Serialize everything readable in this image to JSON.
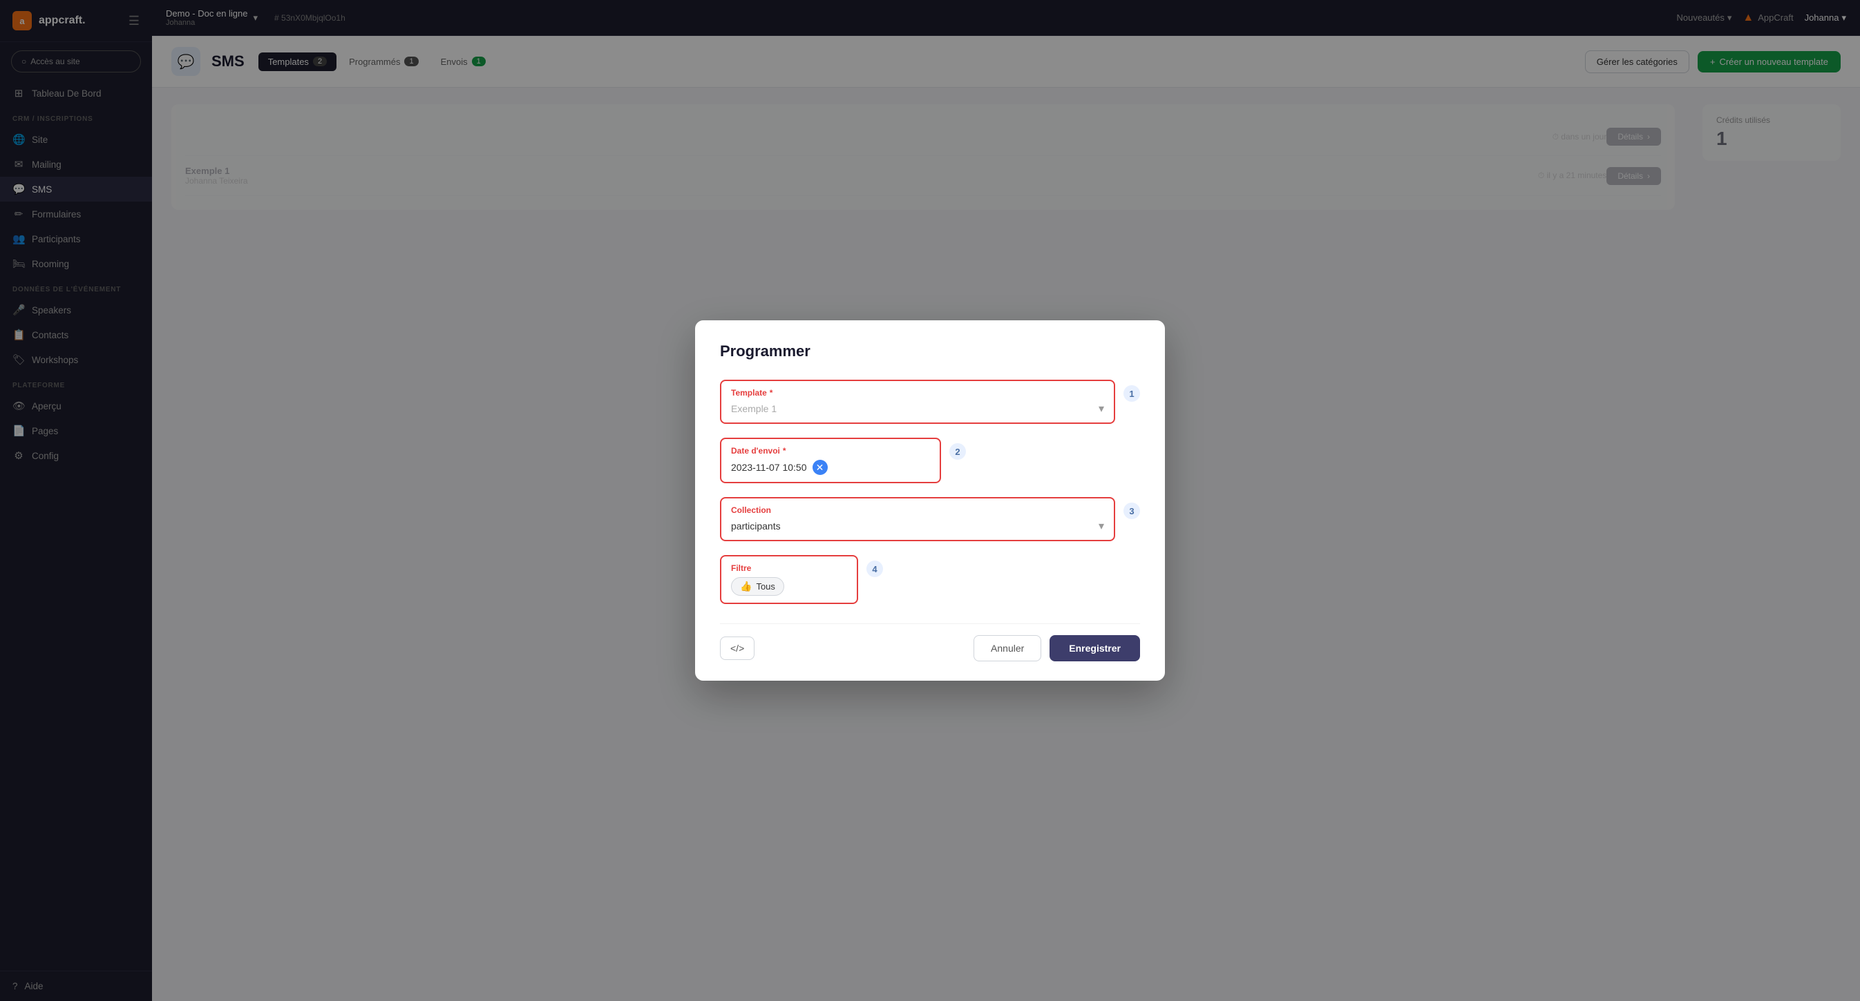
{
  "app": {
    "logo_text": "appcraft.",
    "logo_abbr": "a"
  },
  "topbar": {
    "project_name": "Demo - Doc en ligne",
    "project_sub": "Johanna",
    "hash_label": "# 53nX0MbjqlOo1h",
    "nouveautes": "Nouveautés",
    "appcraft": "AppCraft",
    "user": "Johanna",
    "dropdown_icon": "▾"
  },
  "sidebar": {
    "access_btn": "Accès au site",
    "sections": [
      {
        "label": "",
        "items": [
          {
            "id": "tableau",
            "icon": "⊞",
            "label": "Tableau De Bord"
          }
        ]
      },
      {
        "label": "CRM / INSCRIPTIONS",
        "items": [
          {
            "id": "site",
            "icon": "🌐",
            "label": "Site"
          },
          {
            "id": "mailing",
            "icon": "✉",
            "label": "Mailing"
          },
          {
            "id": "sms",
            "icon": "💬",
            "label": "SMS",
            "active": true
          },
          {
            "id": "formulaires",
            "icon": "✏",
            "label": "Formulaires"
          },
          {
            "id": "participants",
            "icon": "👥",
            "label": "Participants"
          },
          {
            "id": "rooming",
            "icon": "🛏",
            "label": "Rooming"
          }
        ]
      },
      {
        "label": "DONNÉES DE L'ÉVÉNEMENT",
        "items": [
          {
            "id": "speakers",
            "icon": "🎤",
            "label": "Speakers"
          },
          {
            "id": "contacts",
            "icon": "📋",
            "label": "Contacts"
          },
          {
            "id": "workshops",
            "icon": "🏷",
            "label": "Workshops"
          }
        ]
      },
      {
        "label": "PLATEFORME",
        "items": [
          {
            "id": "apercu",
            "icon": "👁",
            "label": "Aperçu"
          },
          {
            "id": "pages",
            "icon": "📄",
            "label": "Pages"
          },
          {
            "id": "config",
            "icon": "⚙",
            "label": "Config"
          }
        ]
      }
    ],
    "help": "Aide"
  },
  "page": {
    "title": "SMS",
    "icon": "💬",
    "tabs": [
      {
        "id": "templates",
        "label": "Templates",
        "badge": "2",
        "active": true
      },
      {
        "id": "programmes",
        "label": "Programmés",
        "badge": "1",
        "active": false
      },
      {
        "id": "envois",
        "label": "Envois",
        "badge": "1",
        "active": false
      }
    ],
    "btn_manage": "Gérer les catégories",
    "btn_create_icon": "+",
    "btn_create": "Créer un nouveau template"
  },
  "bg": {
    "credits_label": "Crédits utilisés",
    "credits_value": "1",
    "row1_time": "dans un jour",
    "row1_details": "Détails",
    "row2_name": "Exemple 1",
    "row2_user": "Johanna Teixeira",
    "row2_time": "il y a 21 minutes",
    "row2_details": "Détails"
  },
  "modal": {
    "title": "Programmer",
    "fields": {
      "template": {
        "label": "Template",
        "required": true,
        "placeholder": "Exemple 1",
        "step": "1"
      },
      "date_envoi": {
        "label": "Date d'envoi",
        "required": true,
        "value": "2023-11-07 10:50",
        "step": "2"
      },
      "collection": {
        "label": "Collection",
        "value": "participants",
        "step": "3"
      },
      "filtre": {
        "label": "Filtre",
        "chip_icon": "👍",
        "chip_label": "Tous",
        "step": "4"
      }
    },
    "btn_code": "</>",
    "btn_cancel": "Annuler",
    "btn_save": "Enregistrer"
  }
}
